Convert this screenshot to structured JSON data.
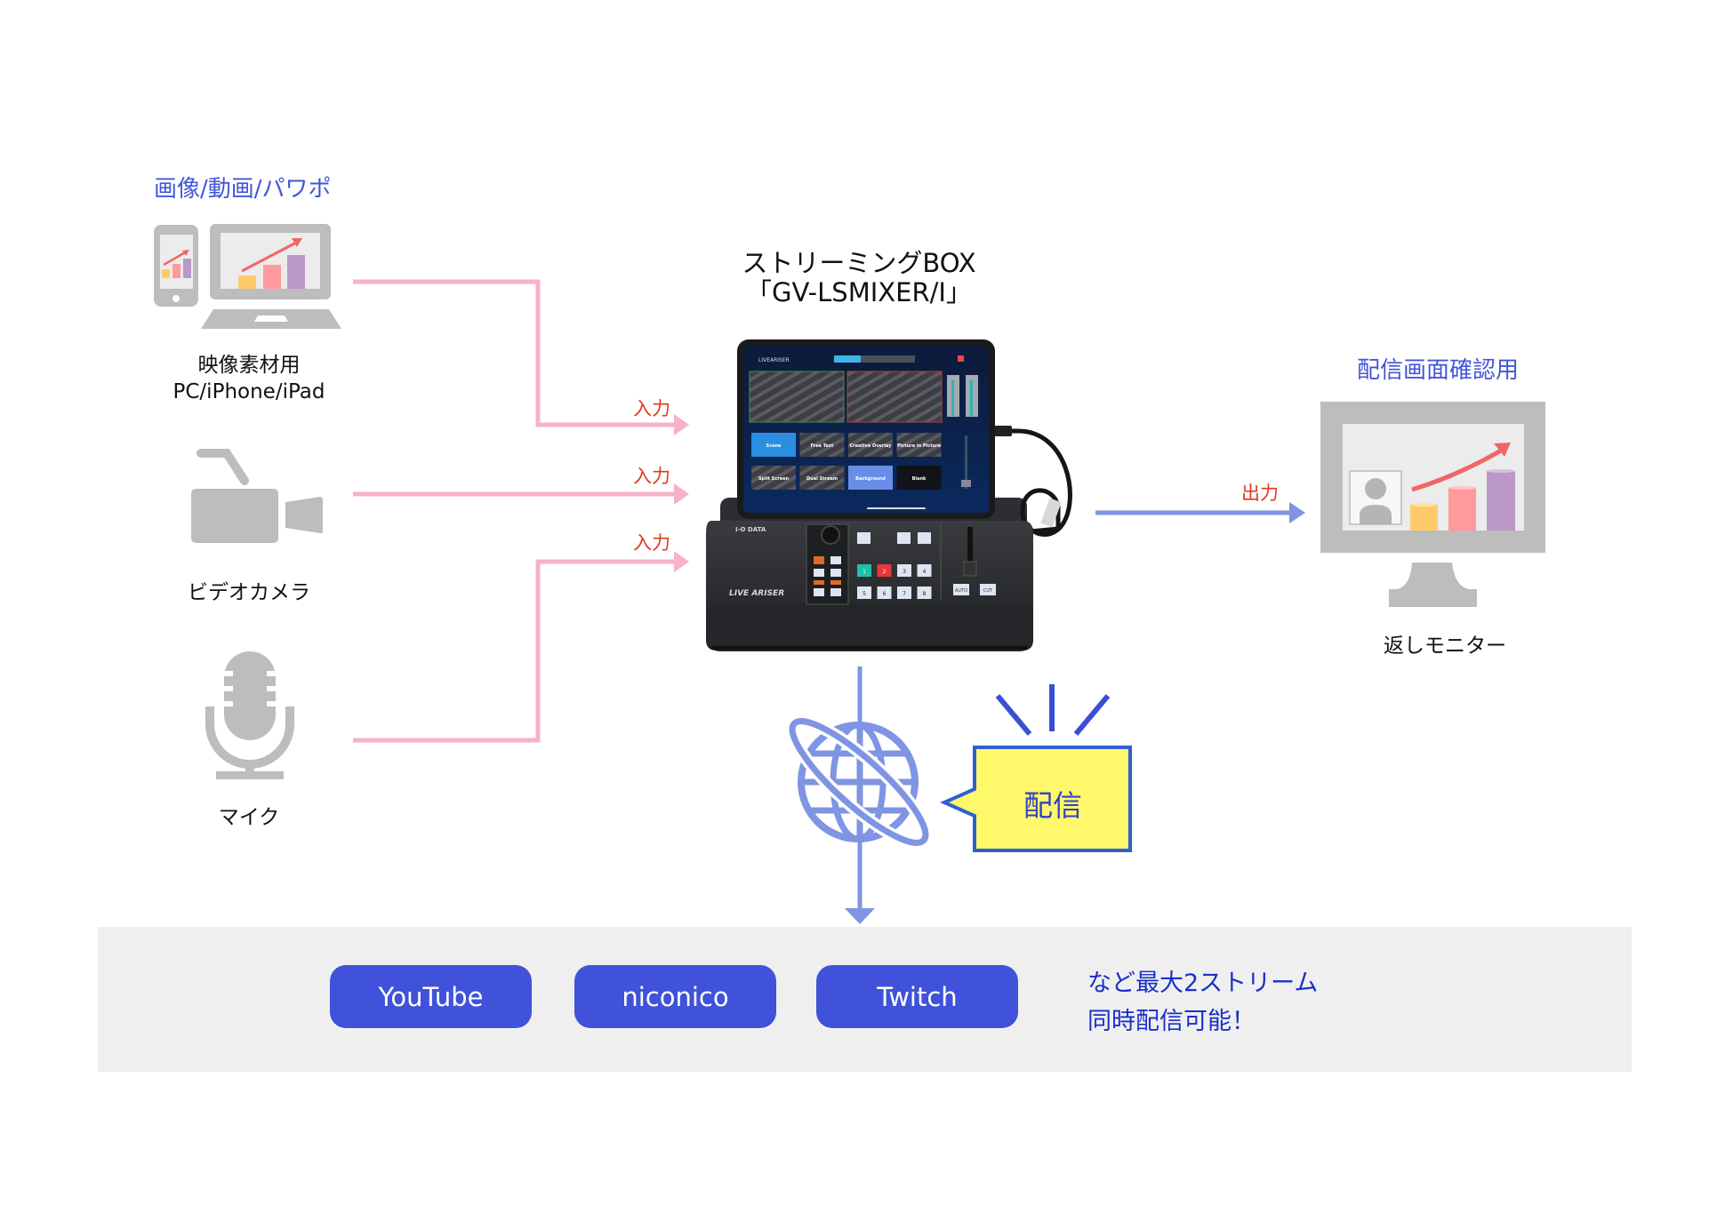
{
  "sources": {
    "media_heading": "画像/動画/パワポ",
    "pc_label_line1": "映像素材用",
    "pc_label_line2": "PC/iPhone/iPad",
    "camera_label": "ビデオカメラ",
    "mic_label": "マイク"
  },
  "inputs": {
    "input_label": "入力"
  },
  "device": {
    "title_line1": "ストリーミングBOX",
    "title_line2": "「GV-LSMIXER/I」",
    "brand": "I-O DATA",
    "product_name": "LIVE ARISER",
    "app_title": "LIVEARISER",
    "scenes": [
      "Scene",
      "Free Text",
      "Creative Overlay",
      "Picture in Picture",
      "Split Screen",
      "Dual Stream",
      "Background",
      "Blank"
    ],
    "scene_buttons": [
      "1",
      "2",
      "3",
      "4",
      "5",
      "6",
      "7",
      "8"
    ],
    "auto_label": "AUTO",
    "cut_label": "CUT"
  },
  "output": {
    "output_label": "出力",
    "monitor_heading": "配信画面確認用",
    "monitor_label": "返しモニター"
  },
  "streaming": {
    "callout_label": "配信"
  },
  "platforms": {
    "buttons": [
      "YouTube",
      "niconico",
      "Twitch"
    ],
    "note_line1": "など最大2ストリーム",
    "note_line2": "同時配信可能！"
  },
  "colors": {
    "input_line": "#f7b1c9",
    "output_line": "#7f94e2",
    "accent_blue": "#4052d9",
    "label_red": "#e0391f",
    "callout_fill": "#fff86b",
    "icon_gray": "#bdbdbd"
  }
}
